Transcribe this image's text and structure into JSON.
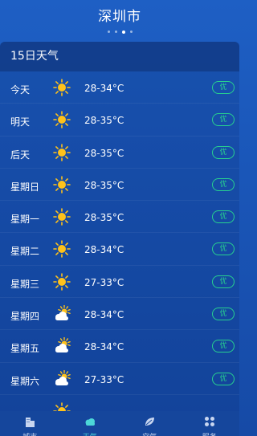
{
  "header": {
    "city": "深圳市"
  },
  "panel": {
    "title": "15日天气"
  },
  "forecast": [
    {
      "day": "今天",
      "icon": "sun-icon",
      "temp": "28-34°C",
      "aqi": "优"
    },
    {
      "day": "明天",
      "icon": "sun-icon",
      "temp": "28-35°C",
      "aqi": "优"
    },
    {
      "day": "后天",
      "icon": "sun-icon",
      "temp": "28-35°C",
      "aqi": "优"
    },
    {
      "day": "星期日",
      "icon": "sun-icon",
      "temp": "28-35°C",
      "aqi": "优"
    },
    {
      "day": "星期一",
      "icon": "sun-icon",
      "temp": "28-35°C",
      "aqi": "优"
    },
    {
      "day": "星期二",
      "icon": "sun-icon",
      "temp": "28-34°C",
      "aqi": "优"
    },
    {
      "day": "星期三",
      "icon": "sun-icon",
      "temp": "27-33°C",
      "aqi": "优"
    },
    {
      "day": "星期四",
      "icon": "partly-cloudy-icon",
      "temp": "28-34°C",
      "aqi": "优"
    },
    {
      "day": "星期五",
      "icon": "partly-cloudy-icon",
      "temp": "28-34°C",
      "aqi": "优"
    },
    {
      "day": "星期六",
      "icon": "partly-cloudy-icon",
      "temp": "27-33°C",
      "aqi": "优"
    },
    {
      "day": "",
      "icon": "sun-icon",
      "temp": "",
      "aqi": ""
    }
  ],
  "tabs": [
    {
      "label": "城市",
      "icon": "city-icon",
      "active": false
    },
    {
      "label": "天气",
      "icon": "weather-icon",
      "active": true
    },
    {
      "label": "空气",
      "icon": "leaf-icon",
      "active": false
    },
    {
      "label": "服务",
      "icon": "grid-icon",
      "active": false
    }
  ],
  "colors": {
    "accent": "#27d18f",
    "sun": "#ffc21a",
    "background": "#1a56b8",
    "tab_active": "#4cd8d8"
  }
}
